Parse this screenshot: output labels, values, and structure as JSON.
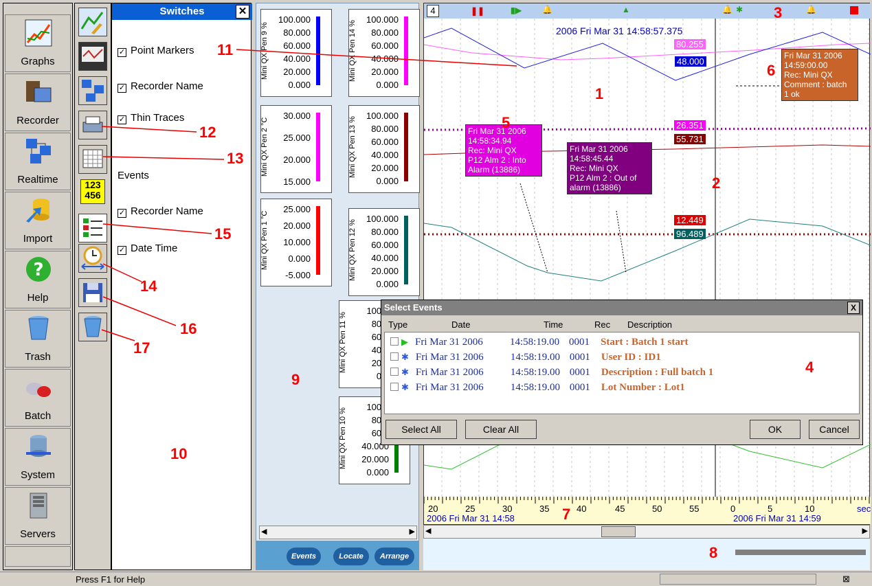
{
  "nav": {
    "items": [
      {
        "label": "Graphs",
        "icon": "graphs-icon"
      },
      {
        "label": "Recorder",
        "icon": "recorder-icon"
      },
      {
        "label": "Realtime",
        "icon": "realtime-icon"
      },
      {
        "label": "Import",
        "icon": "import-icon"
      },
      {
        "label": "Help",
        "icon": "help-icon"
      },
      {
        "label": "Trash",
        "icon": "trash-icon"
      },
      {
        "label": "Batch",
        "icon": "batch-icon"
      },
      {
        "label": "System",
        "icon": "system-icon"
      },
      {
        "label": "Servers",
        "icon": "servers-icon"
      }
    ]
  },
  "switches": {
    "title": "Switches",
    "close": "✕",
    "point_markers": "Point Markers",
    "recorder_name": "Recorder Name",
    "thin_traces": "Thin Traces",
    "events_heading": "Events",
    "events_recorder_name": "Recorder Name",
    "date_time": "Date Time"
  },
  "tools": {
    "numbers_icon_text": "123\n456"
  },
  "pens": [
    {
      "label": "Mini QX Pen 9 %",
      "ticks": [
        "100.000",
        "80.000",
        "60.000",
        "40.000",
        "20.000",
        "0.000"
      ],
      "color": "#0000ff"
    },
    {
      "label": "Mini QX Pen 14 %",
      "ticks": [
        "100.000",
        "80.000",
        "60.000",
        "40.000",
        "20.000",
        "0.000"
      ],
      "color": "#ff00ff"
    },
    {
      "label": "Mini QX Pen 2 °C",
      "ticks": [
        "30.000",
        "25.000",
        "20.000",
        "15.000"
      ],
      "color": "#ff00ff"
    },
    {
      "label": "Mini QX Pen 13 %",
      "ticks": [
        "100.000",
        "80.000",
        "60.000",
        "40.000",
        "20.000",
        "0.000"
      ],
      "color": "#8b0000"
    },
    {
      "label": "Mini QX Pen 1 °C",
      "ticks": [
        "25.000",
        "20.000",
        "10.000",
        "0.000",
        "-5.000"
      ],
      "color": "#ff0000"
    },
    {
      "label": "Mini QX Pen 12 %",
      "ticks": [
        "100.000",
        "80.000",
        "60.000",
        "40.000",
        "20.000",
        "0.000"
      ],
      "color": "#006060"
    },
    {
      "label": "Mini QX Pen 11 %",
      "ticks": [
        "100.0",
        "80.0",
        "60.0",
        "40.0",
        "20.0",
        "0.0"
      ],
      "color": "#008000"
    },
    {
      "label": "Mini QX Pen 10 %",
      "ticks": [
        "100.0",
        "80.0",
        "60.0",
        "40.000",
        "20.000",
        "0.000"
      ],
      "color": "#008000"
    }
  ],
  "pen_buttons": {
    "events": "Events",
    "locate": "Locate",
    "arrange": "Arrange"
  },
  "chart": {
    "top_number": "4",
    "cursor_time": "2006 Fri Mar 31  14:58:57.375",
    "values": {
      "v1": "80.255",
      "v2": "48.000",
      "v3": "26.351",
      "v4": "55.731",
      "v5": "12.449",
      "v6": "96.489"
    },
    "tip1": [
      "Fri Mar 31 2006",
      "14:58:34.94",
      "Rec: Mini QX",
      "P12 Alm 2 : Into",
      "Alarm (13886)"
    ],
    "tip2": [
      "Fri Mar 31 2006",
      "14:58:45.44",
      "Rec: Mini QX",
      "P12 Alm 2 : Out of",
      "alarm (13886)"
    ],
    "tip3": [
      "Fri Mar 31 2006",
      "14:59:00.00",
      "Rec: Mini QX",
      "Comment : batch",
      "1 ok"
    ],
    "axis_ticks": [
      "20",
      "25",
      "30",
      "35",
      "40",
      "45",
      "50",
      "55",
      "0",
      "5",
      "10"
    ],
    "axis_unit": "sec",
    "axis_left_date": "2006 Fri Mar 31  14:58",
    "axis_right_date": "2006 Fri Mar 31  14:59"
  },
  "dialog": {
    "title": "Select Events",
    "close": "X",
    "headers": {
      "type": "Type",
      "date": "Date",
      "time": "Time",
      "rec": "Rec",
      "desc": "Description"
    },
    "rows": [
      {
        "date": "Fri Mar 31 2006",
        "time": "14:58:19.00",
        "rec": "0001",
        "desc": "Start :  Batch 1 start"
      },
      {
        "date": "Fri Mar 31 2006",
        "time": "14:58:19.00",
        "rec": "0001",
        "desc": "User ID : ID1"
      },
      {
        "date": "Fri Mar 31 2006",
        "time": "14:58:19.00",
        "rec": "0001",
        "desc": "Description : Full batch  1"
      },
      {
        "date": "Fri Mar 31 2006",
        "time": "14:58:19.00",
        "rec": "0001",
        "desc": "Lot Number : Lot1"
      }
    ],
    "select_all": "Select All",
    "clear_all": "Clear All",
    "ok": "OK",
    "cancel": "Cancel"
  },
  "callouts": [
    "1",
    "2",
    "3",
    "4",
    "5",
    "6",
    "7",
    "8",
    "9",
    "10",
    "11",
    "12",
    "13",
    "14",
    "15",
    "16",
    "17"
  ],
  "status": {
    "text": "Press F1 for Help"
  }
}
